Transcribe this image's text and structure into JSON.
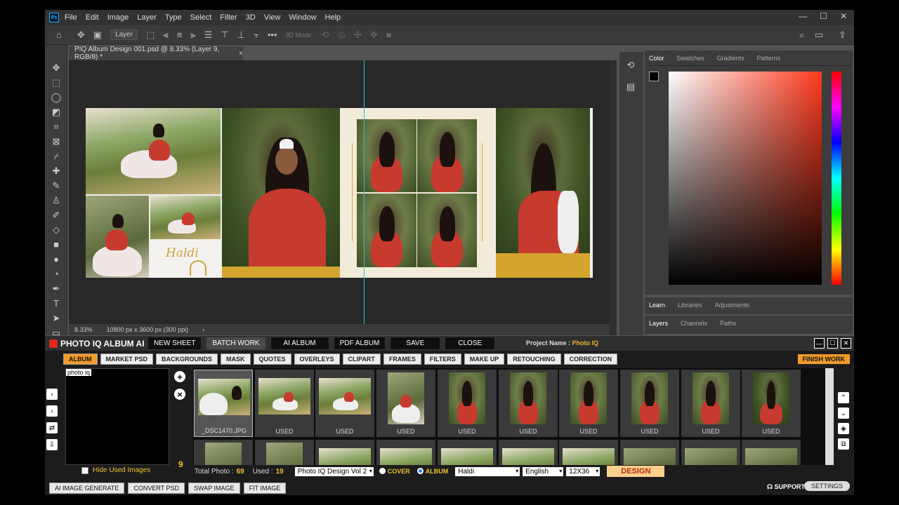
{
  "menubar": {
    "logo": "Ps",
    "items": [
      "File",
      "Edit",
      "Image",
      "Layer",
      "Type",
      "Select",
      "Filter",
      "3D",
      "View",
      "Window",
      "Help"
    ]
  },
  "optionsbar": {
    "layer_select": "Layer",
    "mode_3d": "3D Mode:"
  },
  "document": {
    "tab_title": "PIQ Album Design 001.psd @ 8.33% (Layer 9, RGB/8) *",
    "zoom": "8.33%",
    "dims": "10800 px x 3600 px (300 ppi)",
    "haldi_text": "Haldi"
  },
  "panels": {
    "color_tabs": [
      "Color",
      "Swatches",
      "Gradients",
      "Patterns"
    ],
    "learn_tabs": [
      "Learn",
      "Libraries",
      "Adjustments"
    ],
    "layers_tabs": [
      "Layers",
      "Channels",
      "Paths"
    ]
  },
  "plugin": {
    "title": "PHOTO IQ ALBUM AI",
    "top_buttons": [
      "NEW SHEET",
      "BATCH WORK",
      "AI ALBUM",
      "PDF ALBUM",
      "SAVE",
      "CLOSE"
    ],
    "project_label": "Project Name :",
    "project_name": "Photo IQ",
    "categories": [
      "ALBUM",
      "MARKET PSD",
      "BACKGROUNDS",
      "MASK",
      "QUOTES",
      "OVERLEYS",
      "CLIPART",
      "FRAMES",
      "FILTERS",
      "MAKE UP",
      "RETOUCHING",
      "CORRECTION"
    ],
    "finish_work": "FINISH WORK",
    "preview_label": "photo iq",
    "thumbs": [
      "_DSC1470.JPG",
      "USED",
      "USED",
      "USED",
      "USED",
      "USED",
      "USED",
      "USED",
      "USED",
      "USED"
    ],
    "count": "9",
    "hide_used": "Hide Used Images",
    "total_label": "Total Photo :",
    "total_value": "69",
    "used_label": "Used :",
    "used_value": "19",
    "design_select": "Photo IQ Design Vol 2",
    "cover_label": "COVER",
    "album_label": "ALBUM",
    "event_select": "Haldi",
    "lang_select": "English",
    "size_select": "12X36",
    "design_button": "DESIGN",
    "footer_buttons": [
      "AI IMAGE GENERATE",
      "CONVERT PSD",
      "SWAP IMAGE",
      "FIT IMAGE"
    ],
    "support": "SUPPORT",
    "settings": "SETTINGS"
  },
  "colors": {
    "accent": "#f29b28",
    "guide": "#27c0e0",
    "picker_hue": "#ff3a1e"
  }
}
